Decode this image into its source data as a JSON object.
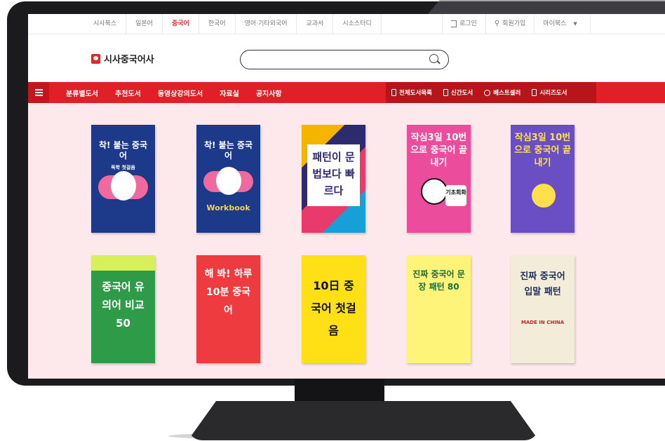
{
  "topbar": {
    "tabs": [
      "시사북스",
      "일본어",
      "중국어",
      "한국어",
      "영어·기타외국어",
      "교과서",
      "시소스터디"
    ],
    "active_tab": "중국어",
    "login": "로그인",
    "signup": "회원가입",
    "mybooks": "마이북스"
  },
  "header": {
    "logo": "시사중국어사",
    "search_placeholder": ""
  },
  "nav": {
    "left": [
      "분류별도서",
      "추천도서",
      "동영상강의도서",
      "자료실",
      "공지사항"
    ],
    "cats": [
      "전체도서목록",
      "신간도서",
      "베스트셀러",
      "시리즈도서"
    ]
  },
  "books": [
    {
      "title": "착! 붙는 중국어",
      "subtitle": "독학 첫걸음",
      "bg": "#1d3a8a",
      "fg": "#ffffff"
    },
    {
      "title": "착! 붙는 중국어",
      "subtitle": "Workbook",
      "bg": "#1d3a8a",
      "fg": "#ffffff"
    },
    {
      "title": "패턴이 문법보다 빠르다",
      "subtitle": "",
      "bg": "#2d2a6e",
      "fg": "#ffffff"
    },
    {
      "title": "작심3일 10번으로 중국어 끝내기",
      "subtitle": "기초회화",
      "bg": "#ec4c9c",
      "fg": "#ffffff"
    },
    {
      "title": "작심3일 10번으로 중국어 끝내기",
      "subtitle": "",
      "bg": "#6a4fc4",
      "fg": "#ffe04a"
    },
    {
      "title": "중국어 유의어 비교 50",
      "subtitle": "",
      "bg": "#2e9b48",
      "fg": "#ffffff"
    },
    {
      "title": "해 봐! 하루 10분 중국어",
      "subtitle": "",
      "bg": "#ee3b3f",
      "fg": "#ffffff"
    },
    {
      "title": "10日 중국어 첫걸음",
      "subtitle": "",
      "bg": "#ffe016",
      "fg": "#111111"
    },
    {
      "title": "진짜 중국어 문장 패턴 80",
      "subtitle": "",
      "bg": "#fff47a",
      "fg": "#1a6e3a"
    },
    {
      "title": "진짜 중국어 입말 패턴",
      "subtitle": "MADE IN CHINA",
      "bg": "#f3ecd9",
      "fg": "#1c2e5a"
    }
  ]
}
